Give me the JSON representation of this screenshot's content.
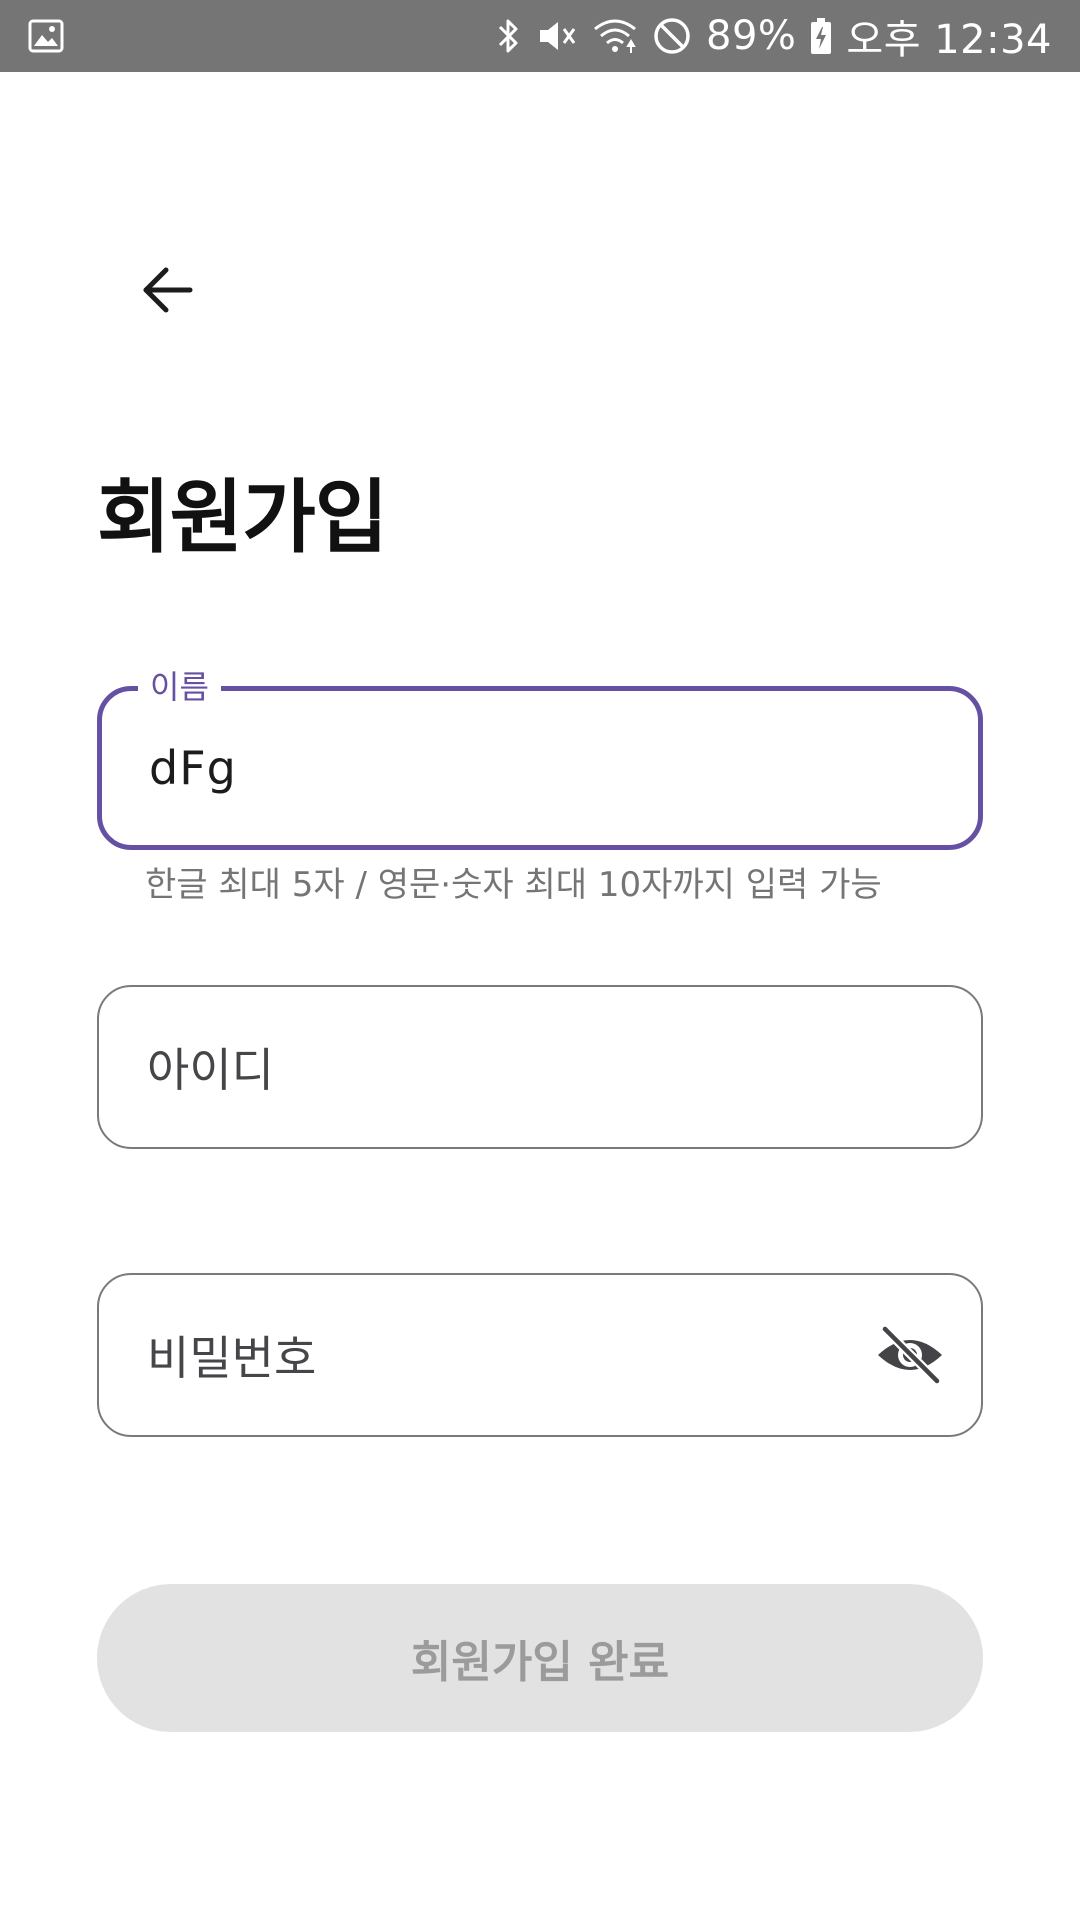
{
  "status_bar": {
    "battery": "89%",
    "time": "오후 12:34",
    "icons": [
      "gallery-icon",
      "bluetooth-icon",
      "vibrate-off-icon",
      "wifi-icon",
      "do-not-disturb-icon",
      "battery-charging-icon"
    ]
  },
  "header": {
    "back_icon": "arrow-back-icon"
  },
  "page": {
    "title": "회원가입"
  },
  "form": {
    "name": {
      "label": "이름",
      "value": "dFg",
      "helper": "한글 최대 5자 / 영문·숫자 최대 10자까지 입력 가능"
    },
    "id": {
      "placeholder": "아이디"
    },
    "password": {
      "placeholder": "비밀번호",
      "toggle_icon": "visibility-off-icon"
    },
    "submit_label": "회원가입 완료"
  },
  "colors": {
    "accent": "#6650a4",
    "status_bar": "#757575",
    "button_disabled_bg": "#e2e2e2",
    "button_disabled_text": "#9b9b9b"
  }
}
